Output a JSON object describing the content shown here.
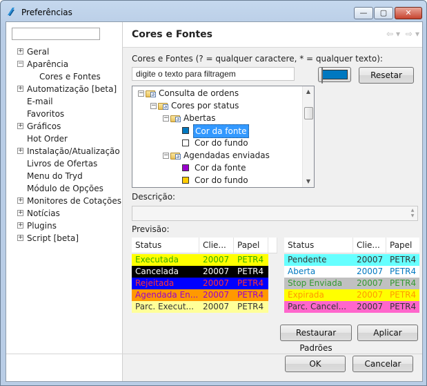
{
  "window": {
    "title": "Preferências",
    "controls": {
      "minimize": "—",
      "maximize": "▢",
      "close": "✕"
    }
  },
  "nav": {
    "search_value": "",
    "items": [
      {
        "label": "Geral",
        "expander": "+",
        "level": 0
      },
      {
        "label": "Aparência",
        "expander": "−",
        "level": 0
      },
      {
        "label": "Cores e Fontes",
        "expander": "",
        "level": 1
      },
      {
        "label": "Automatização [beta]",
        "expander": "+",
        "level": 0
      },
      {
        "label": "E-mail",
        "expander": "",
        "level": 0
      },
      {
        "label": "Favoritos",
        "expander": "",
        "level": 0
      },
      {
        "label": "Gráficos",
        "expander": "+",
        "level": 0
      },
      {
        "label": "Hot Order",
        "expander": "",
        "level": 0
      },
      {
        "label": "Instalação/Atualização",
        "expander": "+",
        "level": 0
      },
      {
        "label": "Livros de Ofertas",
        "expander": "",
        "level": 0
      },
      {
        "label": "Menu do Tryd",
        "expander": "",
        "level": 0
      },
      {
        "label": "Módulo de Opções",
        "expander": "",
        "level": 0
      },
      {
        "label": "Monitores de Cotações",
        "expander": "+",
        "level": 0
      },
      {
        "label": "Notícias",
        "expander": "+",
        "level": 0
      },
      {
        "label": "Plugins",
        "expander": "+",
        "level": 0
      },
      {
        "label": "Script [beta]",
        "expander": "+",
        "level": 0
      }
    ]
  },
  "panel": {
    "title": "Cores e Fontes",
    "filter_label": "Cores e Fontes (? = qualquer caractere, * = qualquer texto):",
    "filter_value": "digite o texto para filtragem",
    "selected_color": "#0078c0",
    "reset_button": "Resetar",
    "tree": [
      {
        "label": "Consulta de ordens",
        "type": "folder",
        "expander": "−"
      },
      {
        "label": "Cores por status",
        "type": "folder",
        "expander": "−"
      },
      {
        "label": "Abertas",
        "type": "folder",
        "expander": "−"
      },
      {
        "label": "Cor da fonte",
        "type": "color",
        "color": "#0078c0",
        "selected": true
      },
      {
        "label": "Cor do fundo",
        "type": "color",
        "color": "#ffffff"
      },
      {
        "label": "Agendadas enviadas",
        "type": "folder",
        "expander": "−"
      },
      {
        "label": "Cor da fonte",
        "type": "color",
        "color": "#9900cc"
      },
      {
        "label": "Cor do fundo",
        "type": "color",
        "color": "#ffcc00"
      }
    ],
    "description_label": "Descrição:",
    "description_value": "",
    "preview_label": "Previsão:",
    "preview_left": {
      "headers": [
        "Status",
        "Clie...",
        "Papel"
      ],
      "rows": [
        {
          "cells": [
            "Executada",
            "20007",
            "PETR4"
          ],
          "bg": "#ffff00",
          "fg": "#33aa00"
        },
        {
          "cells": [
            "Cancelada",
            "20007",
            "PETR4"
          ],
          "bg": "#000000",
          "fg": "#ffffff"
        },
        {
          "cells": [
            "Rejeitada",
            "20007",
            "PETR4"
          ],
          "bg": "#0000ff",
          "fg": "#ff3333"
        },
        {
          "cells": [
            "Agendada En...",
            "20007",
            "PETR4"
          ],
          "bg": "#ff9900",
          "fg": "#9900cc"
        },
        {
          "cells": [
            "Parc. Execut...",
            "20007",
            "PETR4"
          ],
          "bg": "#ffff99",
          "fg": "#333333"
        }
      ]
    },
    "preview_right": {
      "headers": [
        "Status",
        "Clie...",
        "Papel"
      ],
      "rows": [
        {
          "cells": [
            "Pendente",
            "20007",
            "PETR4"
          ],
          "bg": "#66ffff",
          "fg": "#333333"
        },
        {
          "cells": [
            "Aberta",
            "20007",
            "PETR4"
          ],
          "bg": "#ffffff",
          "fg": "#0078c0"
        },
        {
          "cells": [
            "Stop Enviada",
            "20007",
            "PETR4"
          ],
          "bg": "#c0c0c0",
          "fg": "#339933"
        },
        {
          "cells": [
            "Expirada",
            "20007",
            "PETR4"
          ],
          "bg": "#ffff00",
          "fg": "#ff9900"
        },
        {
          "cells": [
            "Parc. Cancel...",
            "20007",
            "PETR4"
          ],
          "bg": "#ff66cc",
          "fg": "#333333"
        }
      ]
    },
    "restore_button": "Restaurar Padrões",
    "apply_button": "Aplicar"
  },
  "footer": {
    "ok_button": "OK",
    "cancel_button": "Cancelar"
  },
  "icons": {
    "back": "⇦",
    "forward": "⇨",
    "dropdown": "▾"
  }
}
